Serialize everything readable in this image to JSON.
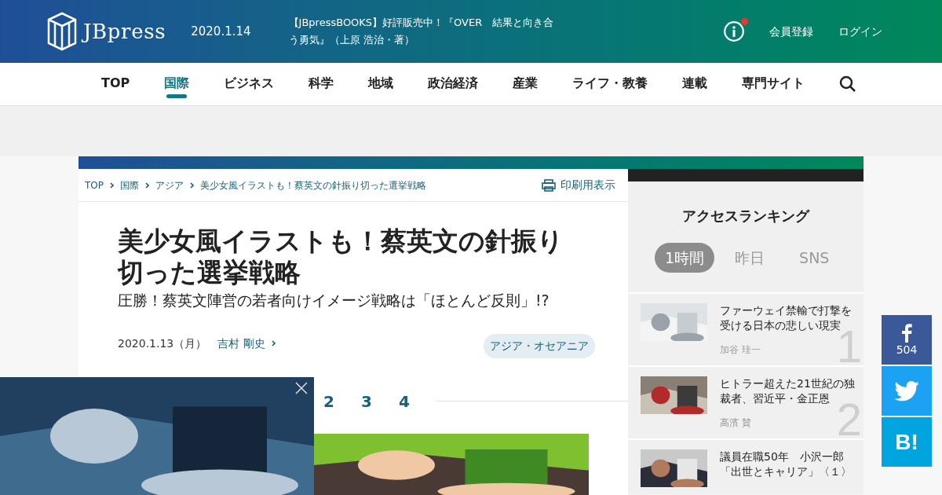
{
  "header": {
    "logo": "JBpress",
    "date": "2020.1.14",
    "notice": "【JBpressBOOKS】好評販売中！『OVER　結果と向き合う勇気』（上原 浩治・著）",
    "notification_dot": true,
    "links": [
      "会員登録",
      "ログイン"
    ]
  },
  "nav": [
    {
      "label": "TOP",
      "selected": false
    },
    {
      "label": "国際",
      "selected": true
    },
    {
      "label": "ビジネス",
      "selected": false
    },
    {
      "label": "科学",
      "selected": false
    },
    {
      "label": "地域",
      "selected": false
    },
    {
      "label": "政治経済",
      "selected": false
    },
    {
      "label": "産業",
      "selected": false
    },
    {
      "label": "ライフ・教養",
      "selected": false
    },
    {
      "label": "連載",
      "selected": false
    },
    {
      "label": "専門サイト",
      "selected": false
    }
  ],
  "breadcrumb": [
    "TOP",
    "国際",
    "アジア",
    "美少女風イラストも！蔡英文の針振り切った選挙戦略"
  ],
  "print_label": "印刷用表示",
  "article": {
    "title": "美少女風イラストも！蔡英文の針振り切った選挙戦略",
    "subtitle": "圧勝！蔡英文陣営の若者向けイメージ戦略は「ほとんど反則」!?",
    "date": "2020.1.13（月）",
    "author": "吉村 剛史",
    "tag": "アジア・オセアニア",
    "pages": [
      "2",
      "3",
      "4"
    ]
  },
  "ranking": {
    "title": "アクセスランキング",
    "tabs": [
      {
        "label": "1時間",
        "selected": true
      },
      {
        "label": "昨日",
        "selected": false
      },
      {
        "label": "SNS",
        "selected": false
      }
    ],
    "items": [
      {
        "rank": "1",
        "title": "ファーウェイ禁輸で打撃を受ける日本の悲しい現実",
        "author": "加谷 珪一"
      },
      {
        "rank": "2",
        "title": "ヒトラー超えた21世紀の独裁者、習近平・金正恩",
        "author": "高濱 賛"
      },
      {
        "title": "議員在職50年　小沢一郎「出世とキャリア」〈１〉"
      }
    ]
  },
  "share": {
    "facebook_count": "504",
    "hatena": "B!"
  }
}
